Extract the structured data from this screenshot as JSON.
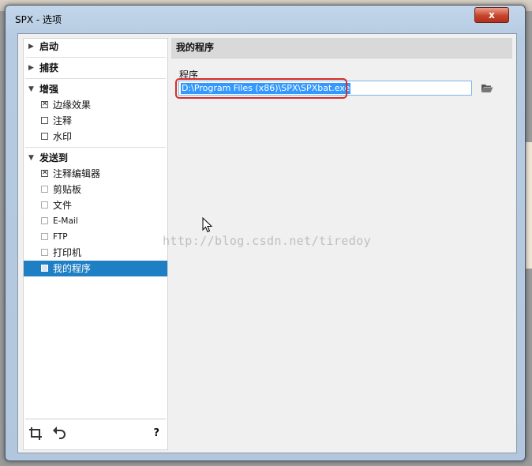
{
  "window": {
    "title": "SPX - 选项",
    "close_label": "x"
  },
  "nav": {
    "groups": [
      {
        "label": "启动",
        "items": []
      },
      {
        "label": "捕获",
        "items": []
      },
      {
        "label": "增强",
        "items": [
          {
            "label": "边缘效果",
            "checked": true
          },
          {
            "label": "注释",
            "checked": false
          },
          {
            "label": "水印",
            "checked": false
          }
        ]
      },
      {
        "label": "发送到",
        "items": [
          {
            "label": "注释编辑器",
            "checked": true
          },
          {
            "label": "剪贴板",
            "checked": false
          },
          {
            "label": "文件",
            "checked": false
          },
          {
            "label": "E-Mail",
            "checked": false
          },
          {
            "label": "FTP",
            "checked": false
          },
          {
            "label": "打印机",
            "checked": false
          },
          {
            "label": "我的程序",
            "checked": false,
            "selected": true
          }
        ]
      }
    ],
    "footer": {
      "help_label": "?"
    }
  },
  "panel": {
    "title": "我的程序",
    "field_label": "程序",
    "path_value": "D:\\Program Files (x86)\\SPX\\SPXbat.exe"
  },
  "watermark": "http://blog.csdn.net/tiredoy",
  "colors": {
    "selection": "#1f7fc4",
    "highlight_box": "#d72c2c",
    "text_selection": "#3399ff"
  }
}
